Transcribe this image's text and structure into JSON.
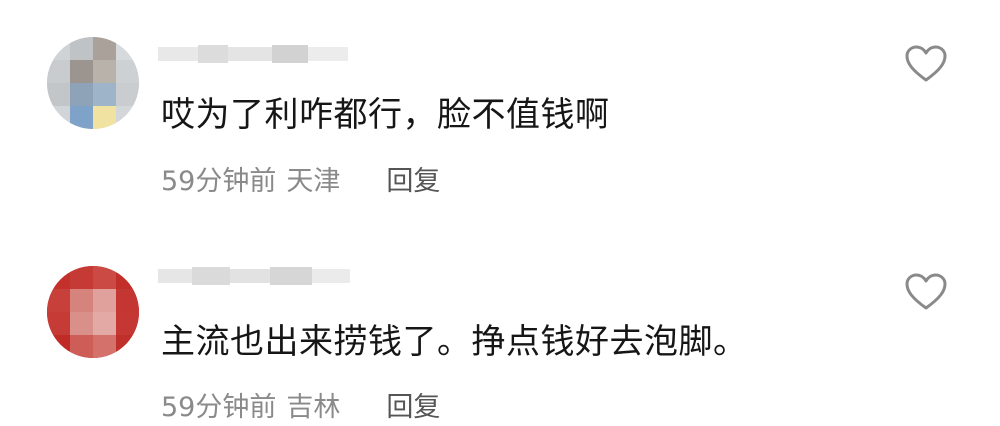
{
  "comments": [
    {
      "text": "哎为了利咋都行，脸不值钱啊",
      "time": "59分钟前",
      "location": "天津",
      "reply_label": "回复",
      "avatar_colors": [
        "#cfd3d6",
        "#bfc3c6",
        "#a9a19a",
        "#d6dadc",
        "#c8ccce",
        "#9c958f",
        "#b8b2ab",
        "#cdd1d3",
        "#c2c6c8",
        "#8fa3b8",
        "#9eb4c8",
        "#c9cdd0",
        "#d1d5d8",
        "#7fa3c8",
        "#f0e2a0",
        "#d3d7da"
      ]
    },
    {
      "text": "主流也出来捞钱了。挣点钱好去泡脚。",
      "time": "59分钟前",
      "location": "吉林",
      "reply_label": "回复",
      "avatar_colors": [
        "#c4302b",
        "#c63a35",
        "#cc4a44",
        "#c22e29",
        "#c8403a",
        "#d6837e",
        "#e0a09b",
        "#c33631",
        "#c63b36",
        "#d98f8a",
        "#e3aaa5",
        "#c53732",
        "#bf2b26",
        "#cf5d57",
        "#d4716b",
        "#c0302b"
      ]
    }
  ],
  "icons": {
    "like": "heart-outline-icon"
  },
  "colors": {
    "text": "#161616",
    "meta": "#8a8a8a",
    "icon_stroke": "#8a8a8a"
  }
}
